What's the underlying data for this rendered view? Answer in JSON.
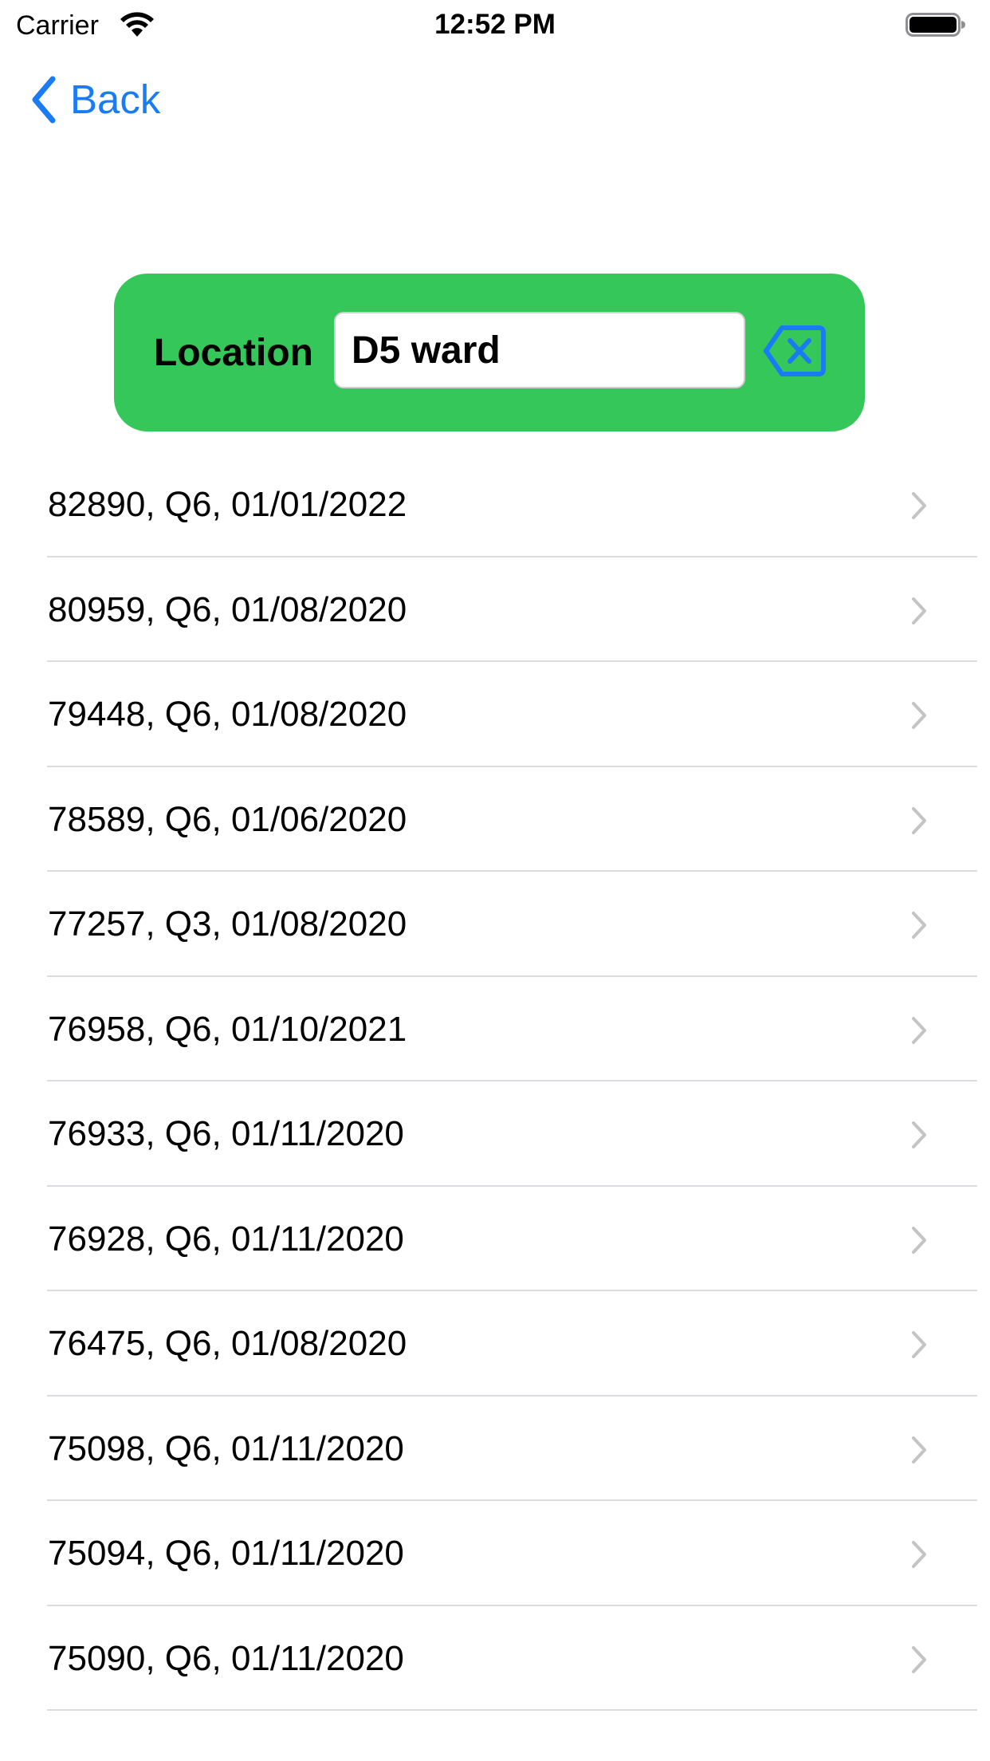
{
  "status_bar": {
    "carrier": "Carrier",
    "time": "12:52 PM",
    "wifi_icon": "wifi-icon",
    "battery_icon": "battery-icon"
  },
  "nav": {
    "back_label": "Back",
    "back_icon": "chevron-left-icon"
  },
  "location": {
    "label": "Location",
    "value": "D5 ward",
    "clear_icon": "delete-backward-icon"
  },
  "list": {
    "items": [
      {
        "label": "82890, Q6, 01/01/2022"
      },
      {
        "label": "80959, Q6, 01/08/2020"
      },
      {
        "label": "79448, Q6, 01/08/2020"
      },
      {
        "label": "78589, Q6, 01/06/2020"
      },
      {
        "label": "77257, Q3, 01/08/2020"
      },
      {
        "label": "76958, Q6, 01/10/2021"
      },
      {
        "label": "76933, Q6, 01/11/2020"
      },
      {
        "label": "76928, Q6, 01/11/2020"
      },
      {
        "label": "76475, Q6, 01/08/2020"
      },
      {
        "label": "75098, Q6, 01/11/2020"
      },
      {
        "label": "75094, Q6, 01/11/2020"
      },
      {
        "label": "75090, Q6, 01/11/2020"
      }
    ]
  },
  "colors": {
    "accent": "#1a7cf5",
    "panel": "#36c75a",
    "separator": "#dcdce0",
    "chevron": "#c4c4c7"
  }
}
